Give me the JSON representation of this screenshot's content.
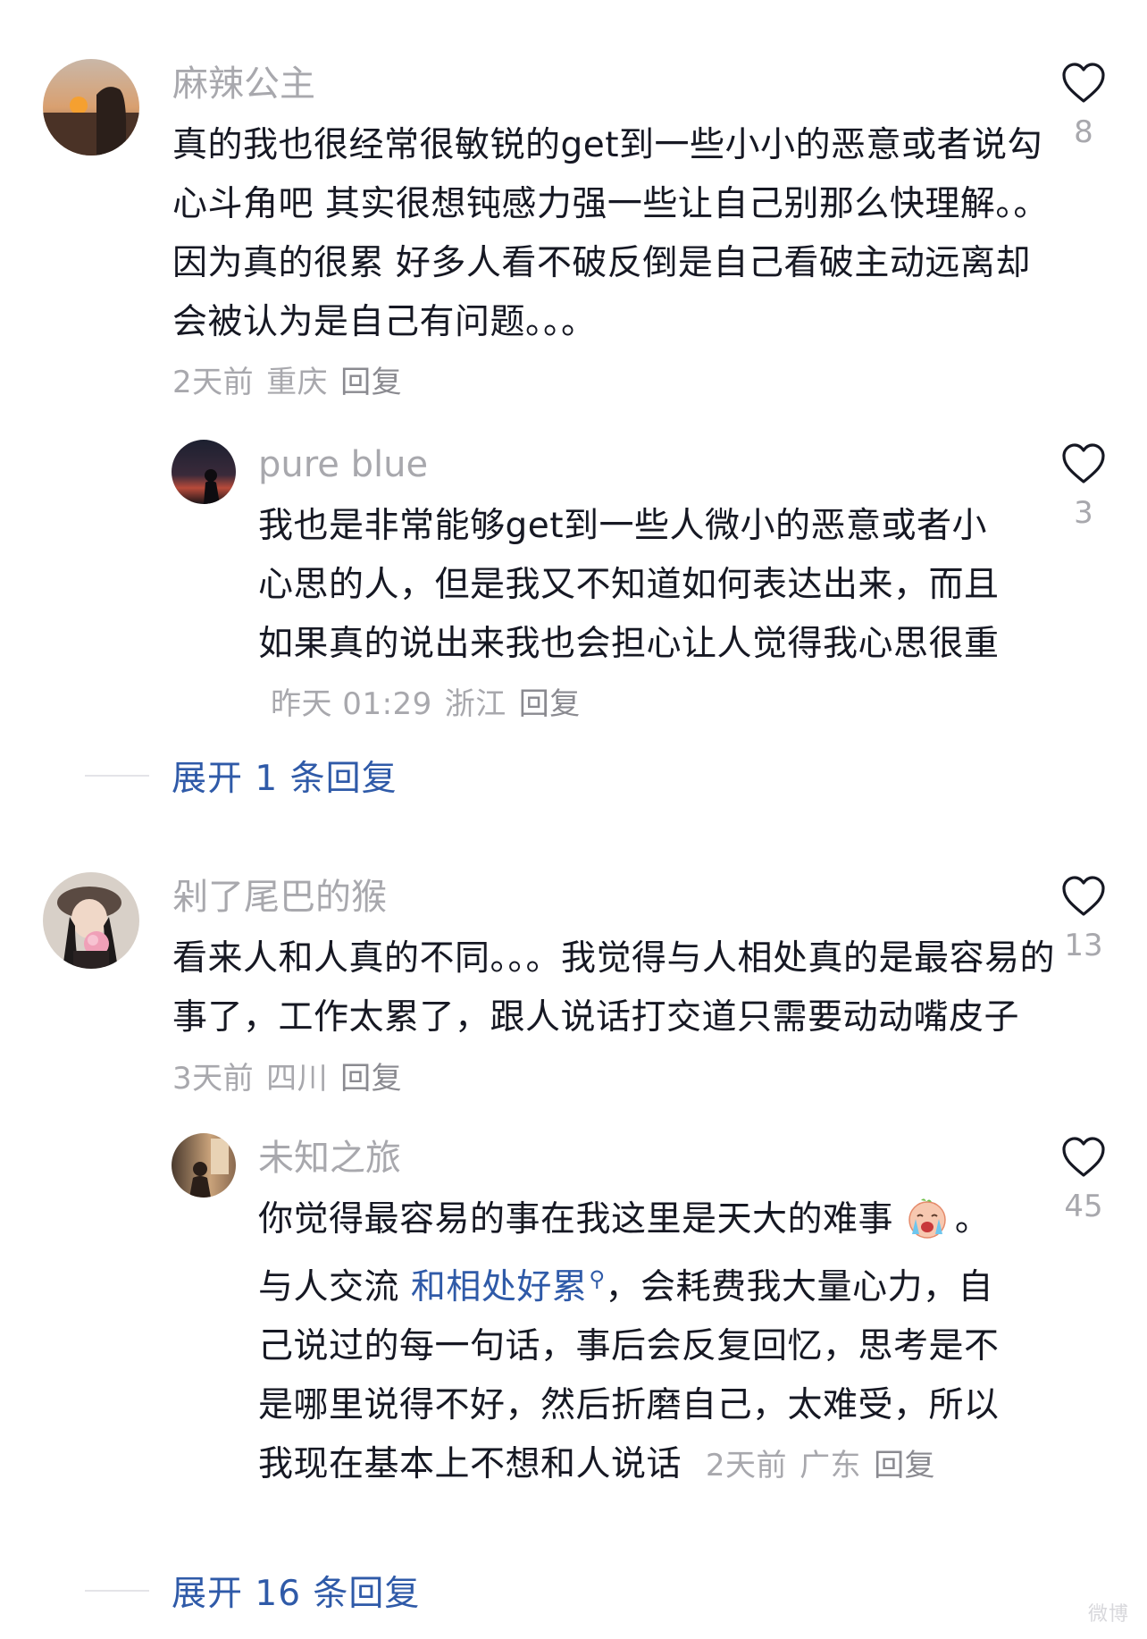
{
  "comments": [
    {
      "username": "麻辣公主",
      "text": "真的我也很经常很敏锐的get到一些小小的恶意或者说勾心斗角吧 其实很想钝感力强一些让自己别那么快理解。。因为真的很累 好多人看不破反倒是自己看破主动远离却会被认为是自己有问题。。。",
      "time": "2天前",
      "location": "重庆",
      "reply": "回复",
      "likes": "8"
    },
    {
      "username": "pure blue",
      "text": "我也是非常能够get到一些人微小的恶意或者小心思的人，但是我又不知道如何表达出来，而且如果真的说出来我也会担心让人觉得我心思很重",
      "time": "昨天 01:29",
      "location": "浙江",
      "reply": "回复",
      "likes": "3"
    },
    {
      "username": "剁了尾巴的猴",
      "text": "看来人和人真的不同。。。我觉得与人相处真的是最容易的事了，工作太累了，跟人说话打交道只需要动动嘴皮子",
      "time": "3天前",
      "location": "四川",
      "reply": "回复",
      "likes": "13"
    },
    {
      "username": "未知之旅",
      "text_before": "你觉得最容易的事在我这里是天大的难事",
      "emoji": "crying-face-emoji",
      "text_mid": "。与人交流 ",
      "highlight": "和相处好累",
      "highlight_icon": "search-icon",
      "text_after": "，会耗费我大量心力，自己说过的每一句话，事后会反复回忆，思考是不是哪里说得不好，然后折磨自己，太难受，所以我现在基本上不想和人说话",
      "time": "2天前",
      "location": "广东",
      "reply": "回复",
      "likes": "45"
    }
  ],
  "expand_replies": [
    {
      "label": "展开 1 条回复"
    },
    {
      "label": "展开 16 条回复"
    }
  ],
  "colors": {
    "text": "#161823",
    "muted": "#a8a8ad",
    "link": "#2f5aa8"
  },
  "watermark": "微博"
}
